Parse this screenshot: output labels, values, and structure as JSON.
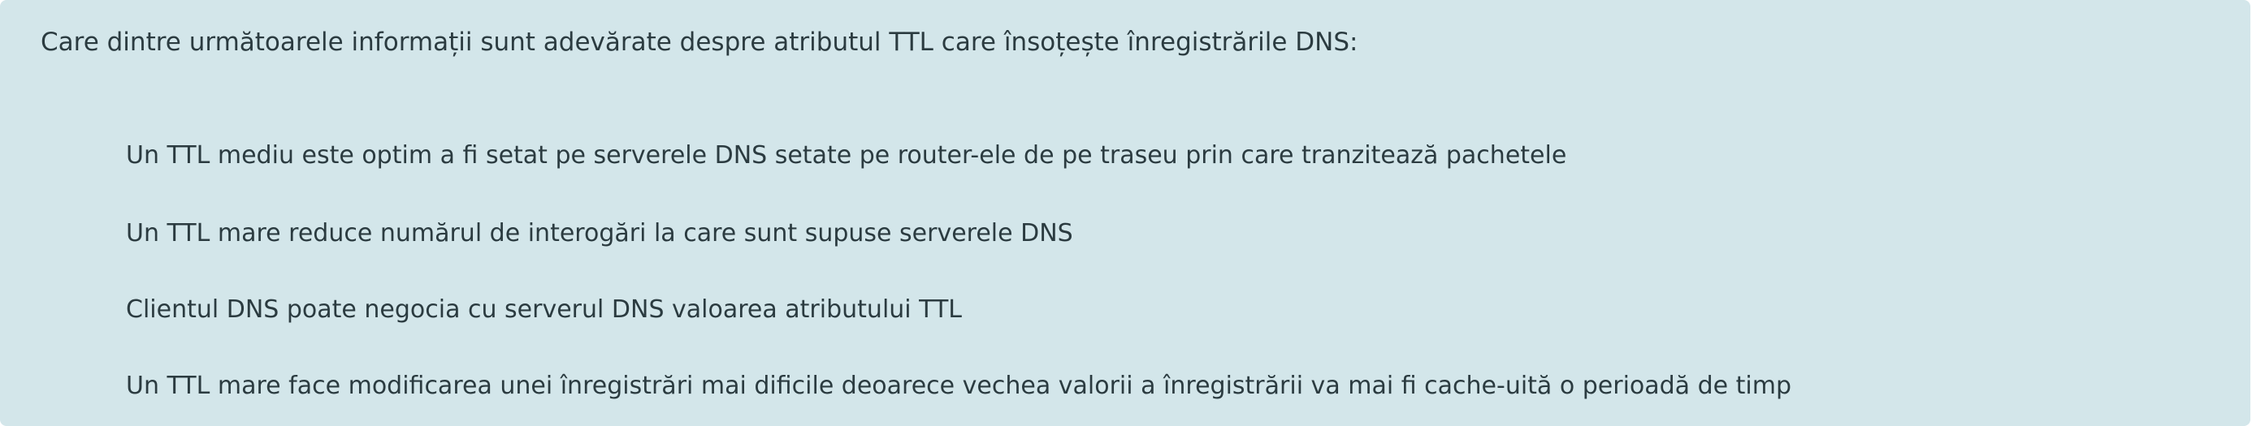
{
  "question": {
    "text": "Care dintre următoarele informații sunt adevărate despre atributul TTL care însoțește înregistrările DNS:"
  },
  "answers": [
    {
      "label": "Un TTL mediu este optim a fi setat pe serverele DNS setate pe router-ele de pe traseu prin care tranzitează pachetele"
    },
    {
      "label": "Un TTL mare reduce numărul de interogări la care sunt supuse serverele DNS"
    },
    {
      "label": "Clientul DNS poate negocia cu serverul DNS valoarea atributului TTL"
    },
    {
      "label": "Un TTL mare face modificarea unei înregistrări mai dificile deoarece vechea valorii a înregistrării va mai fi cache-uită o perioadă de timp"
    }
  ],
  "colors": {
    "panel_background": "#d3e6ea",
    "text": "#2b3b40"
  }
}
